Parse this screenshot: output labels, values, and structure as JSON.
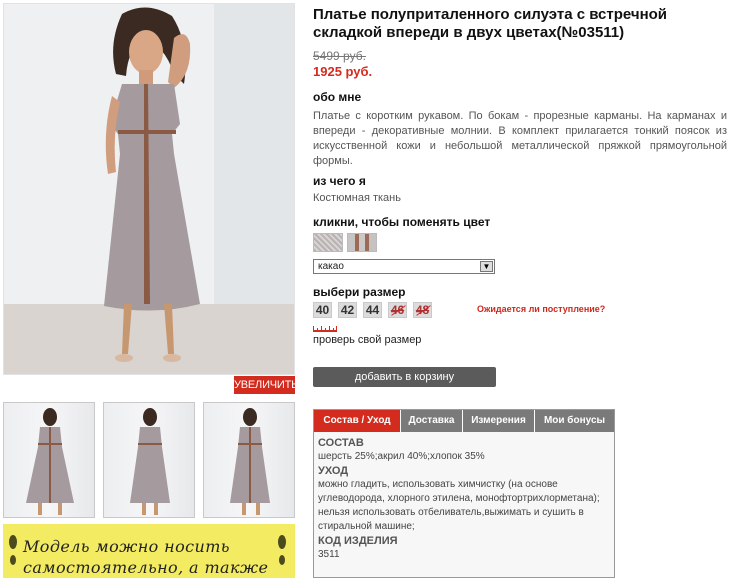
{
  "product": {
    "title": "Платье полуприталенного силуэта с встречной складкой впереди в двух цветах(№03511)",
    "old_price": "5499 руб.",
    "new_price": "1925 руб.",
    "zoom_label": "УВЕЛИЧИТЬ"
  },
  "about": {
    "heading": "обо мне",
    "text": "Платье с коротким рукавом. По бокам - прорезные карманы. На карманах и впереди - декоративные молнии. В комплект прилагается тонкий поясок из искусственной кожи и небольшой металлической пряжкой прямоугольной формы."
  },
  "material": {
    "heading": "из чего я",
    "text": "Костюмная ткань"
  },
  "color": {
    "heading": "кликни, чтобы поменять цвет",
    "selected": "какао"
  },
  "size": {
    "heading": "выбери размер",
    "options": [
      {
        "label": "40",
        "available": true
      },
      {
        "label": "42",
        "available": true
      },
      {
        "label": "44",
        "available": true
      },
      {
        "label": "46",
        "available": false
      },
      {
        "label": "48",
        "available": false
      }
    ],
    "notify_label": "Ожидается ли поступление?",
    "check_label": "проверь свой размер"
  },
  "cart": {
    "add_label": "добавить в корзину"
  },
  "tabs": {
    "items": [
      "Состав / Уход",
      "Доставка",
      "Измерения",
      "Мои бонусы"
    ],
    "active": "Состав / Уход",
    "composition_heading": "СОСТАВ",
    "composition_text": "шерсть 25%;акрил 40%;хлопок 35%",
    "care_heading": "УХОД",
    "care_text": "можно гладить, использовать химчистку (на основе углеводорода, хлорного этилена, монофтортрихлорметана); нельзя использовать отбеливатель,выжимать и сушить в стиральной машине;",
    "code_heading": "КОД ИЗДЕЛИЯ",
    "code_value": "3511"
  },
  "promo": {
    "text": "Модель можно носить самостоятельно, а также"
  },
  "colors": {
    "accent": "#d32b1e",
    "button": "#5b5b5b",
    "promo_bg": "#f3ec63"
  }
}
